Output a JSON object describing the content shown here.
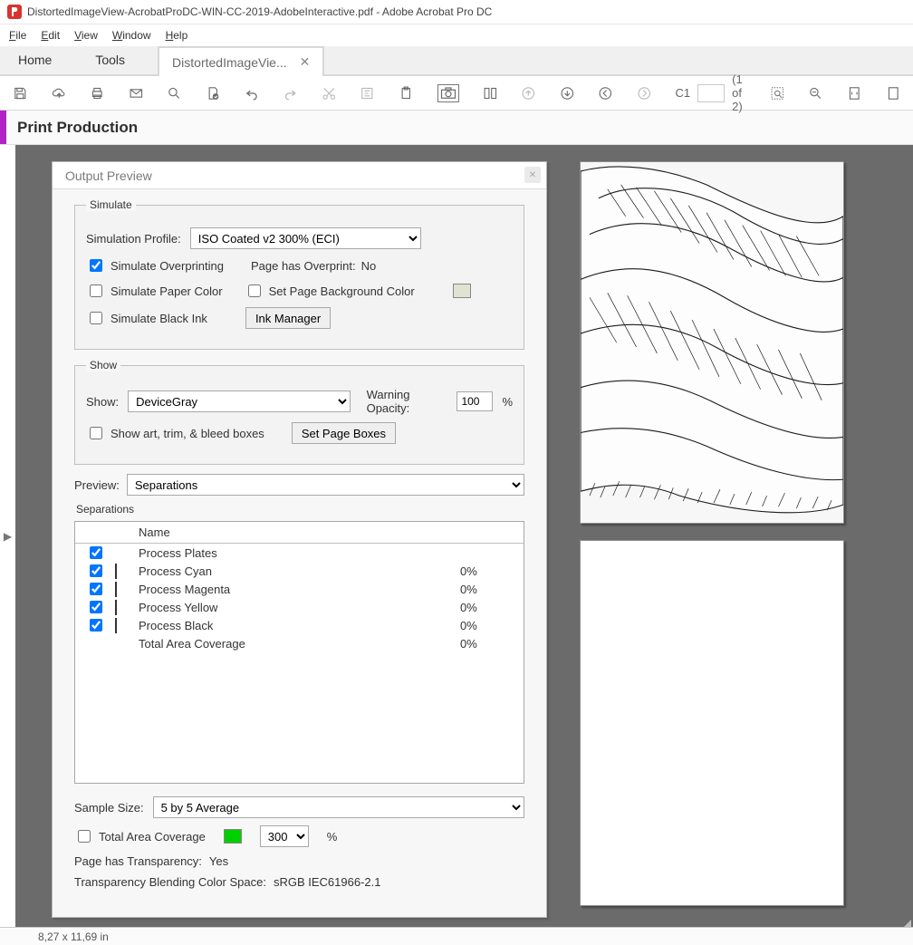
{
  "window": {
    "title": "DistortedImageView-AcrobatProDC-WIN-CC-2019-AdobeInteractive.pdf - Adobe Acrobat Pro DC"
  },
  "menubar": {
    "file": "File",
    "edit": "Edit",
    "view": "View",
    "window": "Window",
    "help": "Help"
  },
  "tabs": {
    "home": "Home",
    "tools": "Tools",
    "file_tab": "DistortedImageVie..."
  },
  "toolbar": {
    "custom_label": "C1",
    "page_value": "",
    "page_count": "(1 of 2)"
  },
  "panel": {
    "title": "Print Production"
  },
  "dialog": {
    "title": "Output Preview",
    "simulate_legend": "Simulate",
    "sim_profile_label": "Simulation Profile:",
    "sim_profile_value": "ISO Coated v2 300% (ECI)",
    "sim_overprinting": "Simulate Overprinting",
    "page_has_overprint_label": "Page has Overprint:",
    "page_has_overprint_value": "No",
    "sim_paper_color": "Simulate Paper Color",
    "set_page_bg_color": "Set Page Background Color",
    "sim_black_ink": "Simulate Black Ink",
    "ink_manager_btn": "Ink Manager",
    "show_legend": "Show",
    "show_label": "Show:",
    "show_value": "DeviceGray",
    "warning_opacity_label": "Warning Opacity:",
    "warning_opacity_value": "100",
    "warning_opacity_pct": "%",
    "show_art_trim": "Show art, trim, & bleed boxes",
    "set_page_boxes_btn": "Set Page Boxes",
    "preview_label": "Preview:",
    "preview_value": "Separations",
    "separations_legend": "Separations",
    "sep_name_header": "Name",
    "sep_rows": [
      {
        "checked": true,
        "swatch": "",
        "name": "Process Plates",
        "pct": ""
      },
      {
        "checked": true,
        "swatch": "#00FFFF",
        "name": "Process Cyan",
        "pct": "0%"
      },
      {
        "checked": true,
        "swatch": "#FF00FF",
        "name": "Process Magenta",
        "pct": "0%"
      },
      {
        "checked": true,
        "swatch": "#FFFF00",
        "name": "Process Yellow",
        "pct": "0%"
      },
      {
        "checked": true,
        "swatch": "#000000",
        "name": "Process Black",
        "pct": "0%"
      },
      {
        "checked": false,
        "swatch": "",
        "name": "Total Area Coverage",
        "pct": "0%"
      }
    ],
    "sample_size_label": "Sample Size:",
    "sample_size_value": "5 by 5 Average",
    "total_area_coverage": "Total Area Coverage",
    "tac_value": "300",
    "tac_pct": "%",
    "page_has_transparency_label": "Page has Transparency:",
    "page_has_transparency_value": "Yes",
    "blend_cs_label": "Transparency Blending Color Space:",
    "blend_cs_value": "sRGB IEC61966-2.1"
  },
  "status": {
    "text": "8,27 x 11,69 in"
  }
}
